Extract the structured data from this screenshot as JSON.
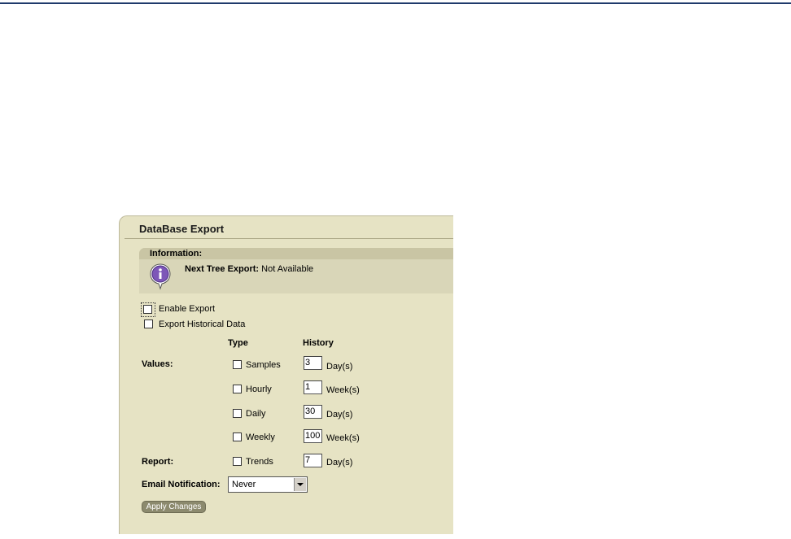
{
  "panel": {
    "title": "DataBase Export",
    "info_header": "Information:",
    "info_label": "Next Tree Export:",
    "info_value": "Not Available"
  },
  "options": {
    "enable_export": "Enable Export",
    "export_historical": "Export Historical Data"
  },
  "columns": {
    "type": "Type",
    "history": "History"
  },
  "values_label": "Values:",
  "report_label": "Report:",
  "rows": [
    {
      "type": "Samples",
      "value": "3",
      "unit": "Day(s)"
    },
    {
      "type": "Hourly",
      "value": "1",
      "unit": "Week(s)"
    },
    {
      "type": "Daily",
      "value": "30",
      "unit": "Day(s)"
    },
    {
      "type": "Weekly",
      "value": "100",
      "unit": "Week(s)"
    },
    {
      "type": "Trends",
      "value": "7",
      "unit": "Day(s)"
    }
  ],
  "email": {
    "label": "Email Notification:",
    "selected": "Never"
  },
  "apply_label": "Apply Changes",
  "icons": {
    "info": "info-icon",
    "dropdown": "chevron-down-icon"
  },
  "colors": {
    "panel_bg": "#e6e3c4",
    "header_rule": "#1f3a6b",
    "button": "#8c8a6e"
  }
}
